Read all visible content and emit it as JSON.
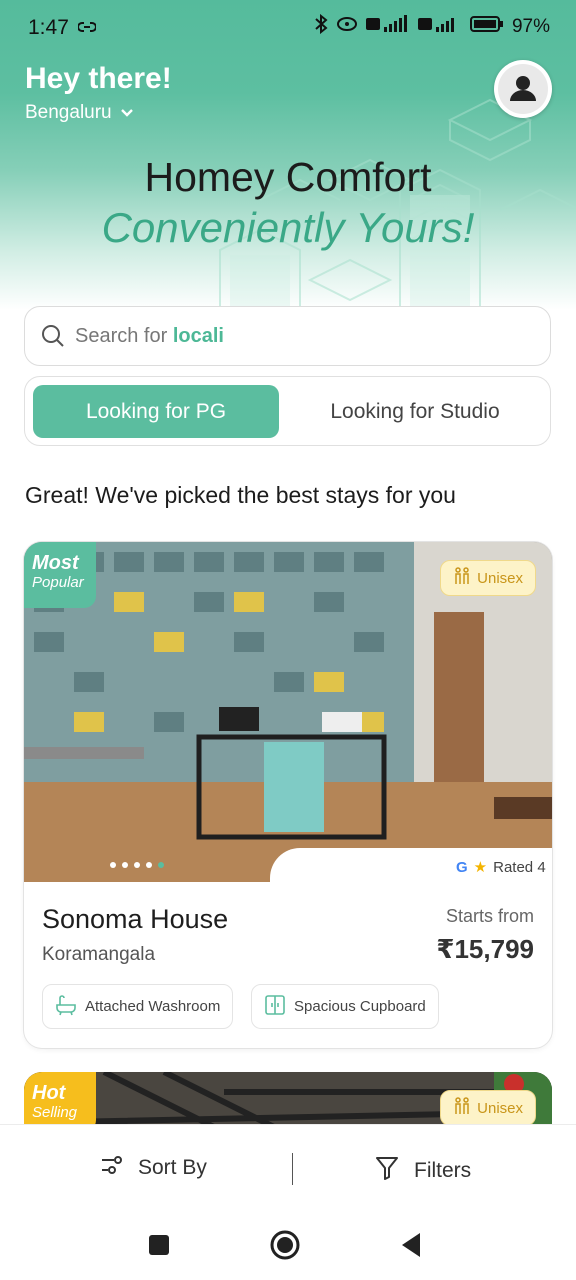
{
  "status_bar": {
    "time": "1:47",
    "battery": "97%"
  },
  "header": {
    "greeting": "Hey there!",
    "city": "Bengaluru"
  },
  "hero": {
    "title": "Homey Comfort",
    "subtitle": "Conveniently Yours!"
  },
  "search": {
    "prefix": "Search for",
    "highlight": "locali"
  },
  "toggle": {
    "active": "Looking for PG",
    "inactive": "Looking for Studio"
  },
  "section_title": "Great! We've picked the best stays for you",
  "listings": [
    {
      "badge_line1": "Most",
      "badge_line2": "Popular",
      "gender_tag": "Unisex",
      "rating": "Rated 4",
      "name": "Sonoma House",
      "location": "Koramangala",
      "price_label": "Starts from",
      "price": "₹15,799",
      "amenities": [
        "Attached Washroom",
        "Spacious Cupboard"
      ],
      "carousel_dots": 5,
      "carousel_active": 5
    },
    {
      "badge_line1": "Hot",
      "badge_line2": "Selling",
      "gender_tag": "Unisex"
    }
  ],
  "bottom_bar": {
    "sort": "Sort By",
    "filters": "Filters"
  },
  "colors": {
    "accent": "#5bbd9f",
    "accent_text": "#3aa887",
    "hot": "#f6be1d",
    "unisex_bg": "#fdf3c8"
  }
}
